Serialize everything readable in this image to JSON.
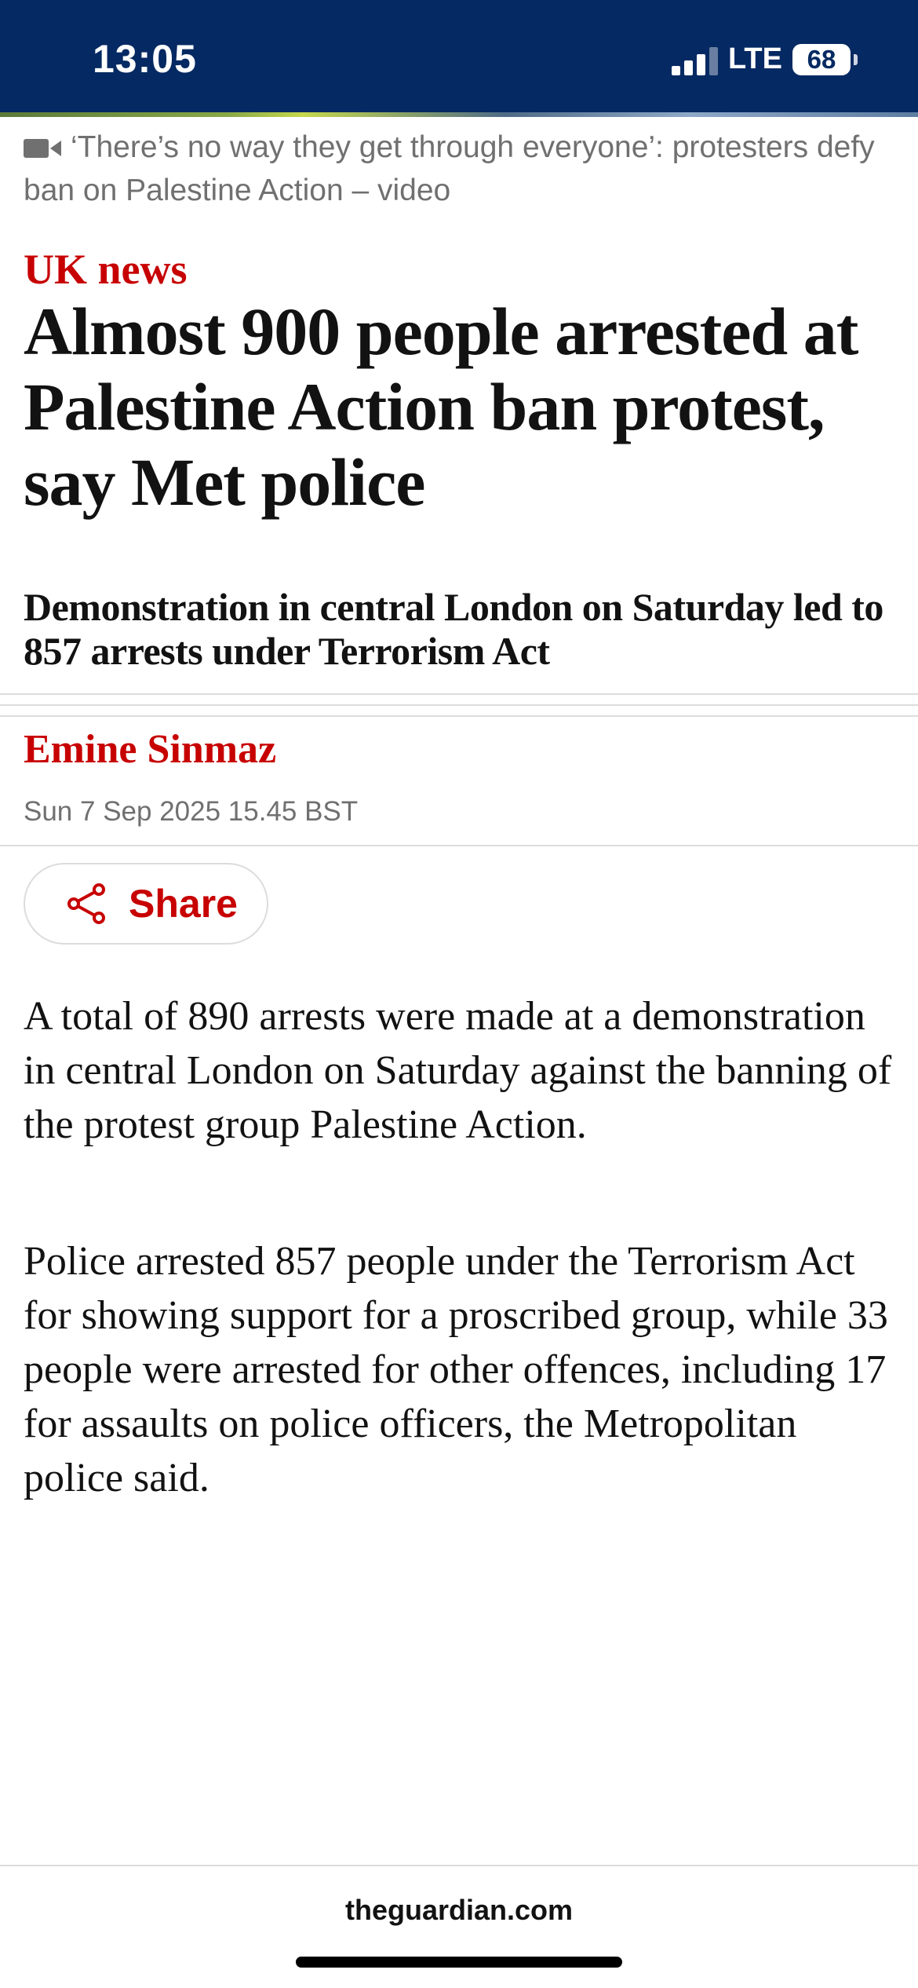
{
  "status_bar": {
    "time": "13:05",
    "network": "LTE",
    "battery_level": "68",
    "signal_bars_filled": 3,
    "signal_bars_total": 4
  },
  "video_caption": {
    "icon": "video-camera-icon",
    "text": "‘There’s no way they get through everyone’: protesters defy ban on Palestine Action – video"
  },
  "article": {
    "section": "UK news",
    "headline": "Almost 900 people arrested at Palestine Action ban protest, say Met police",
    "standfirst": "Demonstration in central London on Saturday led to 857 arrests under Terrorism Act",
    "author": "Emine Sinmaz",
    "published": "Sun 7 Sep 2025 15.45 BST",
    "share_label": "Share",
    "share_icon": "share-icon",
    "paragraphs": [
      "A total of 890 arrests were made at a demonstration in central London on Saturday against the banning of the protest group Palestine Action.",
      "Police arrested 857 people under the Terrorism Act for showing support for a proscribed group, while 33 people were arrested for other offences, including 17 for assaults on police officers, the Metropolitan police said."
    ]
  },
  "browser": {
    "url": "theguardian.com"
  },
  "colors": {
    "brand_navy": "#052962",
    "news_red": "#c70000",
    "text": "#121212",
    "secondary_text": "#707070"
  }
}
